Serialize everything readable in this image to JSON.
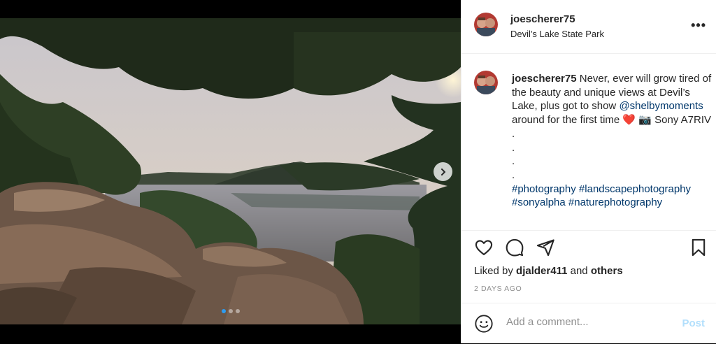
{
  "post": {
    "username": "joescherer75",
    "location": "Devil's Lake State Park",
    "more_icon": "more-horizontal-icon"
  },
  "caption": {
    "username": "joescherer75",
    "text_before_mention": "Never, ever will grow tired of the beauty and unique views at Devil’s Lake, plus got to show",
    "mention": "@shelbymoments",
    "text_after_mention": "around for the first time",
    "heart": "❤️",
    "camera": "📷",
    "camera_text": "Sony A7RIV",
    "dot": ".",
    "hashtags": [
      "#photography",
      "#landscapephotography",
      "#sonyalpha",
      "#naturephotography"
    ]
  },
  "media": {
    "description_icon": "landscape-photo",
    "carousel_index": 1,
    "carousel_count": 3
  },
  "actions": {
    "icons": [
      "heart-icon",
      "comment-icon",
      "share-icon",
      "bookmark-icon"
    ]
  },
  "likes": {
    "prefix": "Liked by",
    "user": "djalder411",
    "joiner": "and",
    "others": "others"
  },
  "timestamp": "2 DAYS AGO",
  "comment": {
    "placeholder": "Add a comment...",
    "post_label": "Post"
  },
  "colors": {
    "link": "#00376b",
    "post_disabled": "#b2dffc",
    "carousel_active": "#2e9cf0"
  }
}
